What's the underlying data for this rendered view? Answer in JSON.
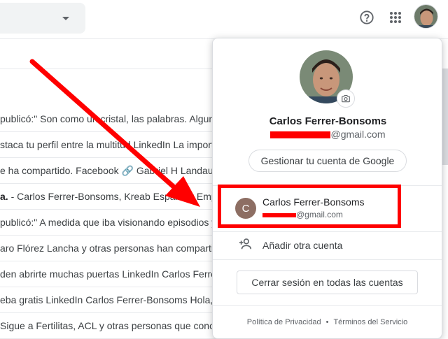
{
  "topbar": {
    "search_dropdown_icon": "caret-down",
    "help_icon": "help-circle",
    "apps_icon": "grid-apps",
    "avatar": "user-photo"
  },
  "mail_list": {
    "rows": [
      {
        "bold": "",
        "text": " publicó:\" Son como un cristal, las palabras. Algunas"
      },
      {
        "bold": "",
        "text": "staca tu perfil entre la multitud LinkedIn La importa"
      },
      {
        "bold": "",
        "text": "e ha compartido. Facebook 🔗 Gabriel H Landauleta"
      },
      {
        "bold": "a.",
        "text": " - Carlos Ferrer-Bonsoms, Kreab España y Empre"
      },
      {
        "bold": "",
        "text": " publicó:\" A medida que iba visionando episodios y"
      },
      {
        "bold": "",
        "text": "aro Flórez Lancha y otras personas han compartido"
      },
      {
        "bold": "",
        "text": "den abrirte muchas puertas LinkedIn Carlos Ferrer-"
      },
      {
        "bold": "",
        "text": "eba gratis LinkedIn Carlos Ferrer-Bonsoms Hola, Ca"
      },
      {
        "bold": "",
        "text": "Sigue a Fertilitas, ACL y otras personas que conoces"
      }
    ]
  },
  "popup": {
    "camera_icon": "camera",
    "name": "Carlos Ferrer-Bonsoms",
    "email_suffix": "@gmail.com",
    "manage_button": "Gestionar tu cuenta de Google",
    "accounts": [
      {
        "initial": "C",
        "name": "Carlos Ferrer-Bonsoms",
        "email_suffix": "@gmail.com",
        "avatar_color": "#8d6e63"
      }
    ],
    "add_account_icon": "person-add",
    "add_account_label": "Añadir otra cuenta",
    "signout_button": "Cerrar sesión en todas las cuentas",
    "footer": {
      "privacy": "Política de Privacidad",
      "separator": "•",
      "terms": "Términos del Servicio"
    }
  },
  "annotations": {
    "arrow_color": "#ff0000",
    "highlight_color": "#ff0000",
    "redaction_color": "#ff0000"
  }
}
